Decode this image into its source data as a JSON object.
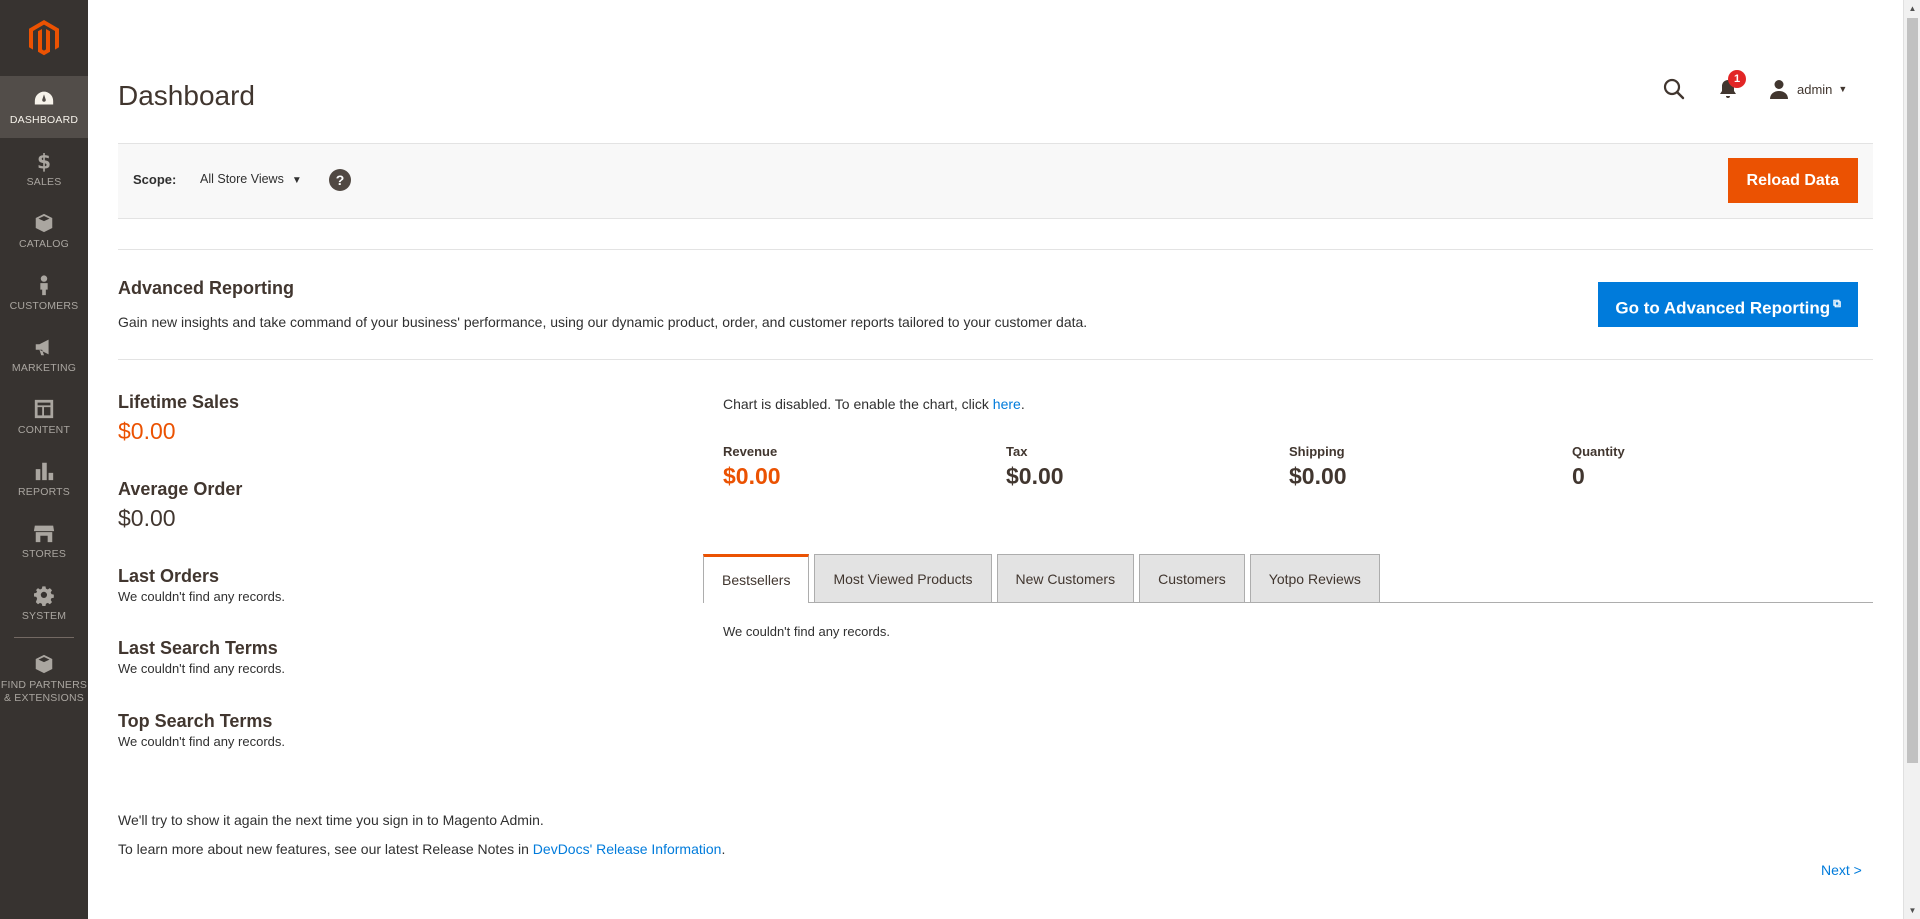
{
  "sidebar": {
    "items": [
      {
        "label": "DASHBOARD",
        "icon": "dashboard-icon"
      },
      {
        "label": "SALES",
        "icon": "dollar-icon"
      },
      {
        "label": "CATALOG",
        "icon": "box-icon"
      },
      {
        "label": "CUSTOMERS",
        "icon": "person-icon"
      },
      {
        "label": "MARKETING",
        "icon": "megaphone-icon"
      },
      {
        "label": "CONTENT",
        "icon": "layout-icon"
      },
      {
        "label": "REPORTS",
        "icon": "bar-chart-icon"
      },
      {
        "label": "STORES",
        "icon": "store-icon"
      },
      {
        "label": "SYSTEM",
        "icon": "gear-icon"
      }
    ],
    "partners_line1": "FIND PARTNERS",
    "partners_line2": "& EXTENSIONS"
  },
  "header": {
    "title": "Dashboard",
    "notification_count": "1",
    "user": "admin"
  },
  "scope": {
    "label": "Scope:",
    "value": "All Store Views",
    "help": "?",
    "reload": "Reload Data"
  },
  "advanced": {
    "title": "Advanced Reporting",
    "text": "Gain new insights and take command of your business' performance, using our dynamic product, order, and customer reports tailored to your customer data.",
    "button": "Go to Advanced Reporting"
  },
  "stats": {
    "lifetime_title": "Lifetime Sales",
    "lifetime_value": "$0.00",
    "avg_title": "Average Order",
    "avg_value": "$0.00",
    "last_orders_title": "Last Orders",
    "last_orders_empty": "We couldn't find any records.",
    "last_search_title": "Last Search Terms",
    "last_search_empty": "We couldn't find any records.",
    "top_search_title": "Top Search Terms",
    "top_search_empty": "We couldn't find any records."
  },
  "chart_note": {
    "text": "Chart is disabled. To enable the chart, click ",
    "link": "here",
    "end": "."
  },
  "totals": [
    {
      "label": "Revenue",
      "value": "$0.00"
    },
    {
      "label": "Tax",
      "value": "$0.00"
    },
    {
      "label": "Shipping",
      "value": "$0.00"
    },
    {
      "label": "Quantity",
      "value": "0"
    }
  ],
  "tabs": [
    "Bestsellers",
    "Most Viewed Products",
    "New Customers",
    "Customers",
    "Yotpo Reviews"
  ],
  "tab_empty": "We couldn't find any records.",
  "footer": {
    "line1": "We'll try to show it again the next time you sign in to Magento Admin.",
    "line2_text": "To learn more about new features, see our latest Release Notes in ",
    "line2_link": "DevDocs' Release Information",
    "line2_end": ".",
    "next": "Next >"
  },
  "colors": {
    "accent_orange": "#eb5202",
    "link_blue": "#007bdb",
    "sidebar_bg": "#373330"
  }
}
